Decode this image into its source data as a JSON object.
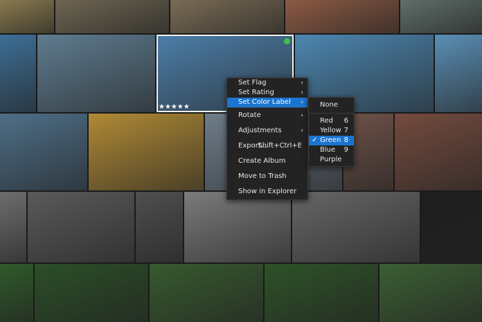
{
  "context_menu": {
    "items": [
      {
        "label": "Set Flag",
        "has_submenu": true
      },
      {
        "label": "Set Rating",
        "has_submenu": true
      },
      {
        "label": "Set Color Label",
        "has_submenu": true
      },
      {
        "label": "Rotate",
        "has_submenu": true
      },
      {
        "label": "Adjustments",
        "has_submenu": true
      },
      {
        "label": "Export...",
        "shortcut": "Shift+Ctrl+E"
      },
      {
        "label": "Create Album"
      },
      {
        "label": "Move to Trash"
      },
      {
        "label": "Show in Explorer"
      }
    ]
  },
  "color_submenu": {
    "items": [
      {
        "label": "None",
        "shortcut": ""
      },
      {
        "label": "Red",
        "shortcut": "6"
      },
      {
        "label": "Yellow",
        "shortcut": "7"
      },
      {
        "label": "Green",
        "shortcut": "8",
        "checked": true
      },
      {
        "label": "Blue",
        "shortcut": "9"
      },
      {
        "label": "Purple",
        "shortcut": ""
      }
    ]
  },
  "selected_photo": {
    "rating": "★★★★★",
    "color_label": "#3ec14a"
  },
  "thumbnails": [
    {
      "c": "#8a7a4e"
    },
    {
      "c": "#6e6552"
    },
    {
      "c": "#7a6b55"
    },
    {
      "c": "#8c5a43"
    },
    {
      "c": "#5f6f6a"
    },
    {
      "c": "#3d6f96"
    },
    {
      "c": "#5f7c90"
    },
    {
      "c": "#4c7ea8"
    },
    {
      "c": "#4c86b0"
    },
    {
      "c": "#5a8fb5"
    },
    {
      "c": "#4e6f88"
    },
    {
      "c": "#b08a35"
    },
    {
      "c": "#6f7d8a"
    },
    {
      "c": "#6e5148"
    },
    {
      "c": "#744b3e"
    },
    {
      "c": "#6e6e6e"
    },
    {
      "c": "#5a5a5a"
    },
    {
      "c": "#4f4f4f"
    },
    {
      "c": "#7b7b7b"
    },
    {
      "c": "#666666"
    },
    {
      "c": "#1e1e1e"
    },
    {
      "c": "#2f5a2a"
    },
    {
      "c": "#2b4e27"
    },
    {
      "c": "#375a2e"
    },
    {
      "c": "#2e5228"
    },
    {
      "c": "#3b5f33"
    }
  ]
}
